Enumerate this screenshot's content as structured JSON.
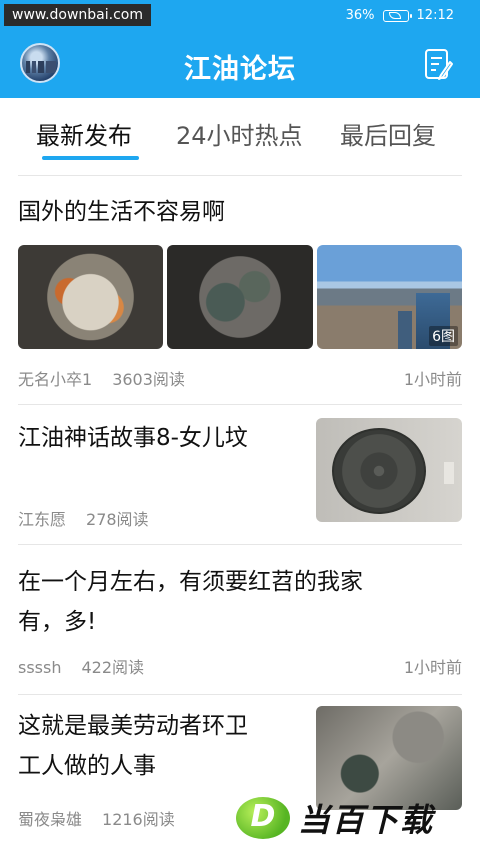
{
  "status_bar": {
    "watermark": "www.downbai.com",
    "battery": "36%",
    "time": "12:12"
  },
  "header": {
    "title": "江油论坛"
  },
  "tabs": [
    {
      "label": "最新发布",
      "active": true
    },
    {
      "label": "24小时热点",
      "active": false
    },
    {
      "label": "最后回复",
      "active": false
    }
  ],
  "posts": [
    {
      "title": "国外的生活不容易啊",
      "author": "无名小卒1",
      "reads": "3603阅读",
      "time": "1小时前",
      "image_count": "6图"
    },
    {
      "title": "江油神话故事8-女儿坟",
      "author": "江东愿",
      "reads": "278阅读"
    },
    {
      "title_line1": "在一个月左右，有须要红苕的我家",
      "title_line2": "有，多!",
      "author": "ssssh",
      "reads": "422阅读",
      "time": "1小时前"
    },
    {
      "title_line1": "这就是最美劳动者环卫",
      "title_line2": "工人做的人事",
      "author": "蜀夜枭雄",
      "reads": "1216阅读"
    }
  ],
  "watermark_bottom": {
    "logo_letter": "D",
    "text": "当百下载"
  },
  "colors": {
    "accent": "#1ea7f0"
  }
}
